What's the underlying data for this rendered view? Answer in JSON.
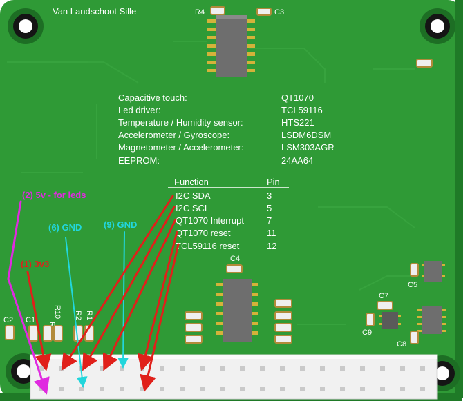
{
  "board": {
    "author": "Van Landschoot Sille",
    "colors": {
      "pcb": "#2f9a36",
      "pcb_dark": "#1f7a27",
      "header": "#f1f1f1",
      "red": "#e0201a",
      "cyan": "#22d6dc",
      "magenta": "#e02ae0"
    }
  },
  "designators": {
    "r4": "R4",
    "c3": "C3",
    "c4": "C4",
    "c5": "C5",
    "c7": "C7",
    "c8": "C8",
    "c9": "C9",
    "c2": "C2",
    "c1": "C1",
    "r3": "R3",
    "r10": "R10",
    "r2": "R2",
    "r1": "R1"
  },
  "components": [
    {
      "label": "Capacitive touch:",
      "part": "QT1070"
    },
    {
      "label": "Led driver:",
      "part": "TCL59116"
    },
    {
      "label": "Temperature / Humidity sensor:",
      "part": "HTS221"
    },
    {
      "label": "Accelerometer / Gyroscope:",
      "part": "LSDM6DSM"
    },
    {
      "label": "Magnetometer / Accelerometer:",
      "part": "LSM303AGR"
    },
    {
      "label": "EEPROM:",
      "part": "24AA64"
    }
  ],
  "pin_table": {
    "header_function": "Function",
    "header_pin": "Pin",
    "rows": [
      {
        "function": "I2C SDA",
        "pin": "3"
      },
      {
        "function": "I2C SCL",
        "pin": "5"
      },
      {
        "function": "QT1070 Interrupt",
        "pin": "7"
      },
      {
        "function": "QT1070 reset",
        "pin": "11"
      },
      {
        "function": "TCL59116 reset",
        "pin": "12"
      }
    ]
  },
  "annotations": {
    "five_volt": "(2)  5v  -  for  leds",
    "gnd_6": "(6) GND",
    "gnd_9": "(9) GND",
    "three_v3": "(1) 3v3"
  }
}
